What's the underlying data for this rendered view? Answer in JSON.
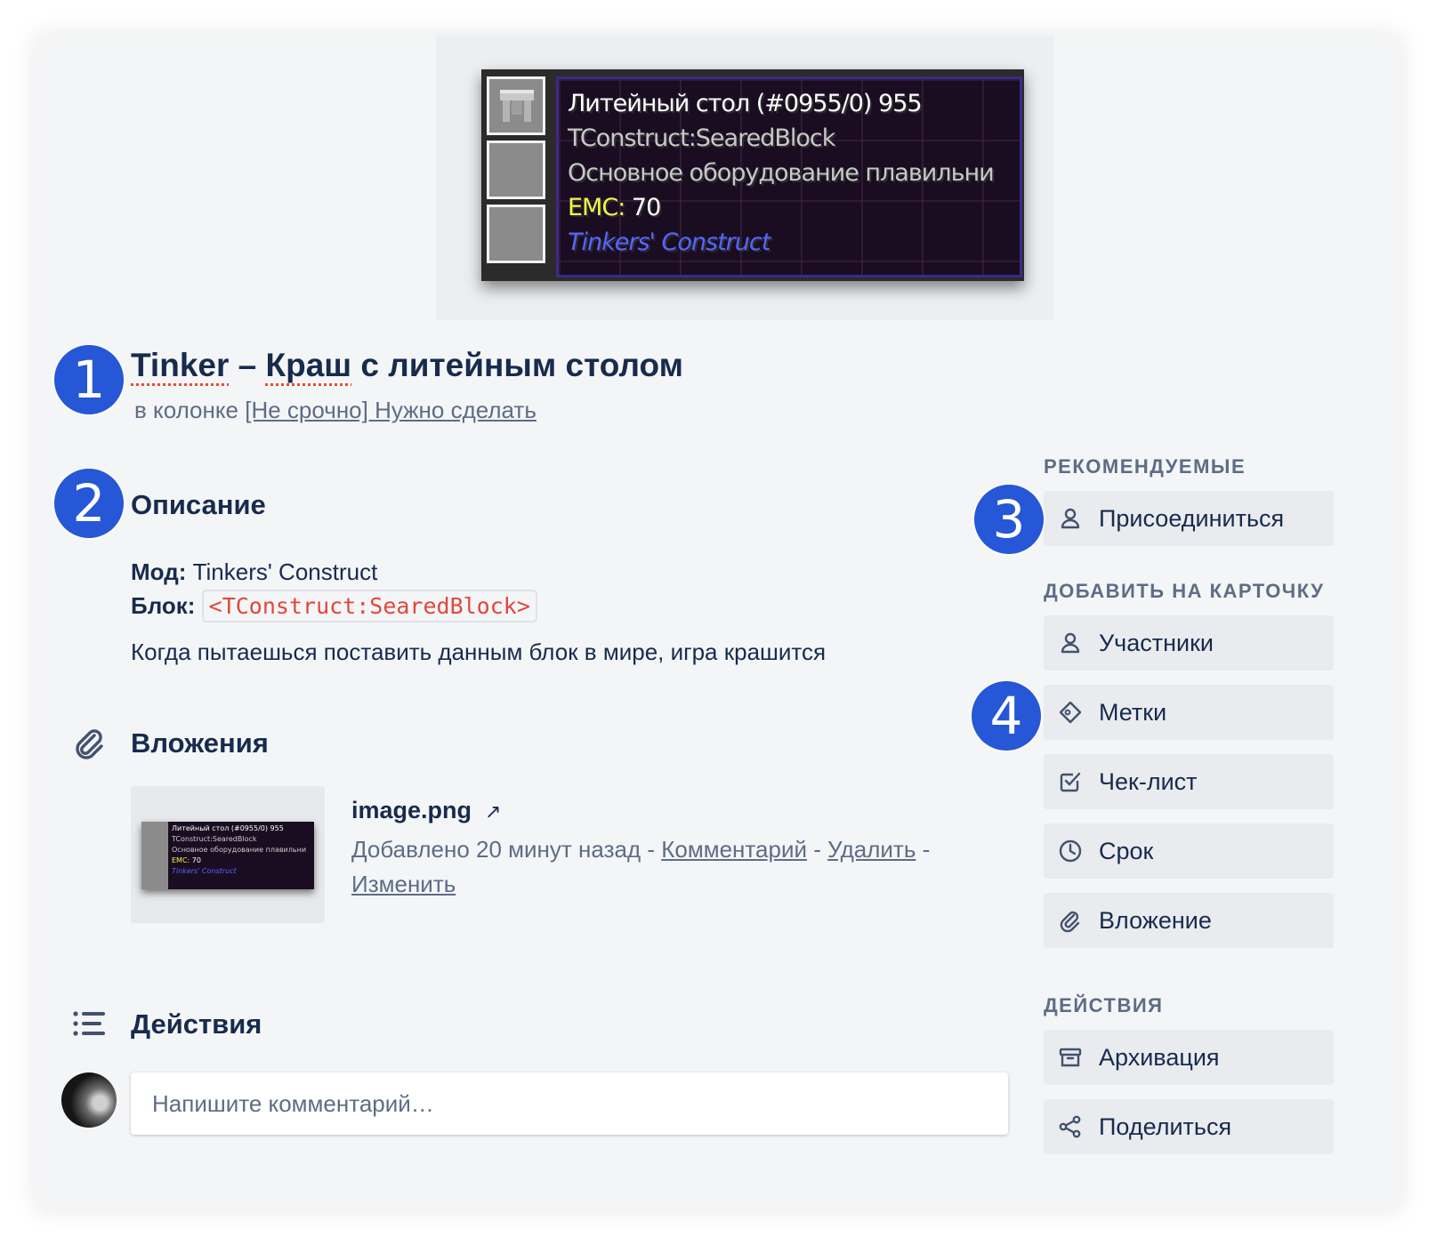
{
  "cover": {
    "tooltip": {
      "title": "Литейный стол (#0955/0) 955",
      "id_line": "TConstruct:SearedBlock",
      "desc_line": "Основное оборудование плавильни",
      "emc_label": "EMC:",
      "emc_value": "70",
      "mod_line": "Tinkers' Construct"
    }
  },
  "markers": [
    "1",
    "2",
    "3",
    "4"
  ],
  "card": {
    "title_word1": "Tinker",
    "title_dash": " – ",
    "title_word2": "Краш",
    "title_rest": " с литейным столом",
    "in_list_prefix": "в колонке ",
    "list_name": "[Не срочно] Нужно сделать"
  },
  "description": {
    "heading": "Описание",
    "mod_label": "Мод:",
    "mod_value": "Tinkers' Construct",
    "block_label": "Блок:",
    "block_value": "<TConstruct:SearedBlock>",
    "text": "Когда пытаешься поставить данным блок в мире, игра крашится"
  },
  "attachments": {
    "heading": "Вложения",
    "item": {
      "name": "image.png",
      "open_icon": "↗",
      "added": "Добавлено 20 минут назад",
      "sep": " - ",
      "comment_link": "Комментарий",
      "delete_link": "Удалить",
      "edit_link": "Изменить"
    }
  },
  "activity": {
    "heading": "Действия",
    "comment_placeholder": "Напишите комментарий…"
  },
  "sidebar": {
    "suggested_heading": "РЕКОМЕНДУЕМЫЕ",
    "join": "Присоединиться",
    "add_heading": "ДОБАВИТЬ НА КАРТОЧКУ",
    "members": "Участники",
    "labels": "Метки",
    "checklist": "Чек-лист",
    "due": "Срок",
    "attachment": "Вложение",
    "actions_heading": "ДЕЙСТВИЯ",
    "archive": "Архивация",
    "share": "Поделиться"
  }
}
